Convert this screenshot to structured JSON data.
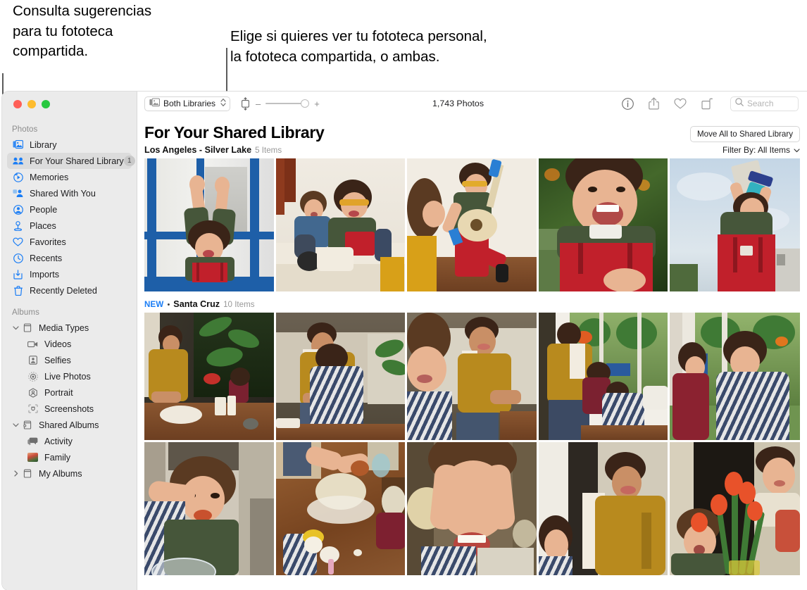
{
  "annotations": {
    "left": "Consulta sugerencias\npara tu fototeca\ncompartida.",
    "right": "Elige si quieres ver tu fototeca personal,\nla fototeca compartida, o ambas."
  },
  "window": {
    "traffic_lights": [
      "close",
      "minimize",
      "zoom"
    ]
  },
  "sidebar": {
    "sections": [
      {
        "title": "Photos",
        "items": [
          {
            "label": "Library",
            "icon": "library-icon",
            "badge": null,
            "selected": false
          },
          {
            "label": "For Your Shared Library",
            "icon": "shared-library-icon",
            "badge": "1",
            "selected": true
          },
          {
            "label": "Memories",
            "icon": "memories-icon",
            "badge": null,
            "selected": false
          },
          {
            "label": "Shared With You",
            "icon": "shared-with-you-icon",
            "badge": null,
            "selected": false
          },
          {
            "label": "People",
            "icon": "people-icon",
            "badge": null,
            "selected": false
          },
          {
            "label": "Places",
            "icon": "places-icon",
            "badge": null,
            "selected": false
          },
          {
            "label": "Favorites",
            "icon": "heart-icon",
            "badge": null,
            "selected": false
          },
          {
            "label": "Recents",
            "icon": "clock-icon",
            "badge": null,
            "selected": false
          },
          {
            "label": "Imports",
            "icon": "import-icon",
            "badge": null,
            "selected": false
          },
          {
            "label": "Recently Deleted",
            "icon": "trash-icon",
            "badge": null,
            "selected": false
          }
        ]
      },
      {
        "title": "Albums",
        "items": [
          {
            "label": "Media Types",
            "icon": "album-box-icon",
            "chevron": "down",
            "group": true
          },
          {
            "label": "Videos",
            "icon": "video-icon",
            "indent": true
          },
          {
            "label": "Selfies",
            "icon": "selfie-icon",
            "indent": true
          },
          {
            "label": "Live Photos",
            "icon": "live-photo-icon",
            "indent": true
          },
          {
            "label": "Portrait",
            "icon": "portrait-icon",
            "indent": true
          },
          {
            "label": "Screenshots",
            "icon": "screenshot-icon",
            "indent": true
          },
          {
            "label": "Shared Albums",
            "icon": "shared-album-icon",
            "chevron": "down",
            "group": true
          },
          {
            "label": "Activity",
            "icon": "activity-icon",
            "indent": true
          },
          {
            "label": "Family",
            "icon": "family-thumb-icon",
            "indent": true
          },
          {
            "label": "My Albums",
            "icon": "album-box-icon",
            "chevron": "right",
            "group": true
          }
        ]
      }
    ]
  },
  "toolbar": {
    "library_selector": "Both Libraries",
    "zoom_minus": "–",
    "zoom_plus": "+",
    "photo_count": "1,743 Photos",
    "icons": [
      "info-icon",
      "share-icon",
      "heart-icon",
      "rotate-icon"
    ],
    "search_placeholder": "Search"
  },
  "main": {
    "title": "For Your Shared Library",
    "move_all_button": "Move All to Shared Library",
    "filter_label": "Filter By: All Items",
    "sections": [
      {
        "new_badge": null,
        "name": "Los Angeles - Silver Lake",
        "count": "5 Items"
      },
      {
        "new_badge": "NEW",
        "bullet": "•",
        "name": "Santa Cruz",
        "count": "10 Items"
      }
    ]
  },
  "colors": {
    "accent_blue": "#1a7df5",
    "sidebar_bg": "#ebebeb",
    "selected_row": "#dcdcdc",
    "badge_bg": "#c9c9c9"
  }
}
